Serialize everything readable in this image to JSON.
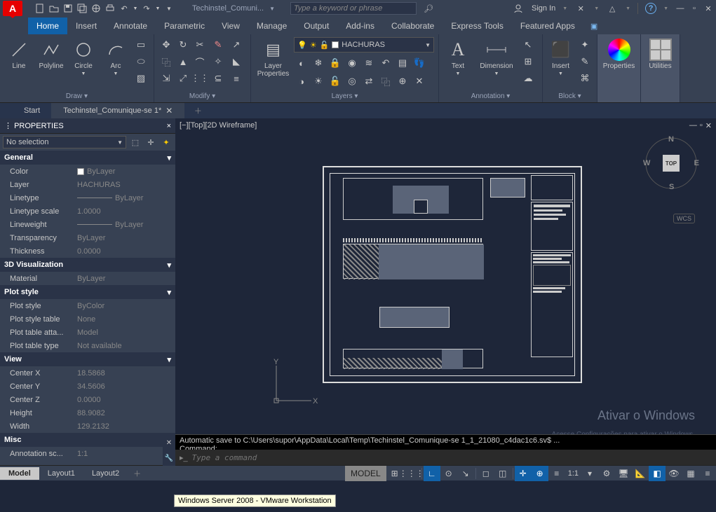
{
  "titlebar": {
    "doc_name": "Techinstel_Comuni...",
    "search_placeholder": "Type a keyword or phrase",
    "sign_in": "Sign In"
  },
  "ribbon_tabs": [
    "Home",
    "Insert",
    "Annotate",
    "Parametric",
    "View",
    "Manage",
    "Output",
    "Add-ins",
    "Collaborate",
    "Express Tools",
    "Featured Apps"
  ],
  "ribbon": {
    "draw": {
      "label": "Draw ▾",
      "line": "Line",
      "polyline": "Polyline",
      "circle": "Circle",
      "arc": "Arc"
    },
    "modify": {
      "label": "Modify ▾"
    },
    "layers": {
      "label": "Layers ▾",
      "layer_properties": "Layer\nProperties",
      "current_layer": "HACHURAS"
    },
    "annotation": {
      "label": "Annotation ▾",
      "text": "Text",
      "dimension": "Dimension"
    },
    "block": {
      "label": "Block ▾",
      "insert": "Insert"
    },
    "properties": {
      "label": "Properties"
    },
    "utilities": {
      "label": "Utilities"
    }
  },
  "file_tabs": {
    "start": "Start",
    "doc": "Techinstel_Comunique-se 1*"
  },
  "properties": {
    "title": "PROPERTIES",
    "selection": "No selection",
    "groups": {
      "general": {
        "title": "General",
        "rows": {
          "color_l": "Color",
          "color_v": "ByLayer",
          "layer_l": "Layer",
          "layer_v": "HACHURAS",
          "linetype_l": "Linetype",
          "linetype_v": "ByLayer",
          "ltscale_l": "Linetype scale",
          "ltscale_v": "1.0000",
          "lweight_l": "Lineweight",
          "lweight_v": "ByLayer",
          "transp_l": "Transparency",
          "transp_v": "ByLayer",
          "thick_l": "Thickness",
          "thick_v": "0.0000"
        }
      },
      "viz3d": {
        "title": "3D Visualization",
        "material_l": "Material",
        "material_v": "ByLayer"
      },
      "plot": {
        "title": "Plot style",
        "ps_l": "Plot style",
        "ps_v": "ByColor",
        "pst_l": "Plot style table",
        "pst_v": "None",
        "pta_l": "Plot table atta...",
        "pta_v": "Model",
        "ptt_l": "Plot table type",
        "ptt_v": "Not available"
      },
      "view": {
        "title": "View",
        "cx_l": "Center X",
        "cx_v": "18.5868",
        "cy_l": "Center Y",
        "cy_v": "34.5606",
        "cz_l": "Center Z",
        "cz_v": "0.0000",
        "h_l": "Height",
        "h_v": "88.9082",
        "w_l": "Width",
        "w_v": "129.2132"
      },
      "misc": {
        "title": "Misc",
        "ann_l": "Annotation sc...",
        "ann_v": "1:1"
      }
    }
  },
  "viewport": {
    "label": "[−][Top][2D Wireframe]",
    "cube": {
      "top": "TOP",
      "n": "N",
      "s": "S",
      "e": "E",
      "w": "W"
    },
    "wcs": "WCS",
    "axes": {
      "x": "X",
      "y": "Y"
    }
  },
  "cmd": {
    "hist1": "Automatic save to C:\\Users\\supor\\AppData\\Local\\Temp\\Techinstel_Comunique-se 1_1_21080_c4dac1c6.sv$ ...",
    "hist2": "Command:",
    "placeholder": "Type a command"
  },
  "watermark": {
    "l1": "Ativar o Windows",
    "l2": "Acesse Configurações para ativar o Windows."
  },
  "layout_tabs": {
    "model": "Model",
    "l1": "Layout1",
    "l2": "Layout2"
  },
  "statusbar": {
    "scale": "1:1"
  },
  "tooltip": "Windows Server 2008 - VMware Workstation"
}
